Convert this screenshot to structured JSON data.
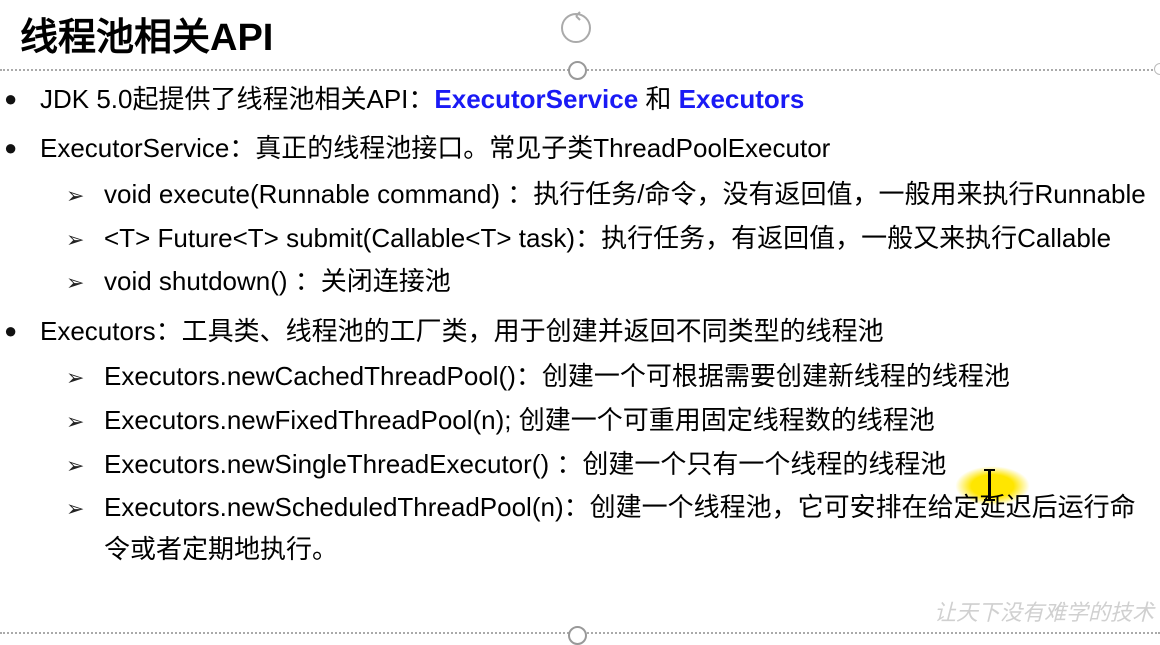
{
  "title": "线程池相关API",
  "bullets": [
    {
      "prefix": "JDK 5.0起提供了线程池相关API：",
      "link1": "ExecutorService",
      "conj": " 和 ",
      "link2": "Executors"
    },
    {
      "text": "ExecutorService：真正的线程池接口。常见子类ThreadPoolExecutor",
      "sub": [
        "void execute(Runnable command) ：执行任务/命令，没有返回值，一般用来执行Runnable",
        "<T> Future<T> submit(Callable<T> task)：执行任务，有返回值，一般又来执行Callable",
        "void shutdown() ：关闭连接池"
      ]
    },
    {
      "text": "Executors：工具类、线程池的工厂类，用于创建并返回不同类型的线程池",
      "sub": [
        "Executors.newCachedThreadPool()：创建一个可根据需要创建新线程的线程池",
        "Executors.newFixedThreadPool(n); 创建一个可重用固定线程数的线程池",
        "Executors.newSingleThreadExecutor() ：创建一个只有一个线程的线程池",
        "Executors.newScheduledThreadPool(n)：创建一个线程池，它可安排在给定延迟后运行命令或者定期地执行。"
      ]
    }
  ],
  "watermark": "让天下没有难学的技术"
}
